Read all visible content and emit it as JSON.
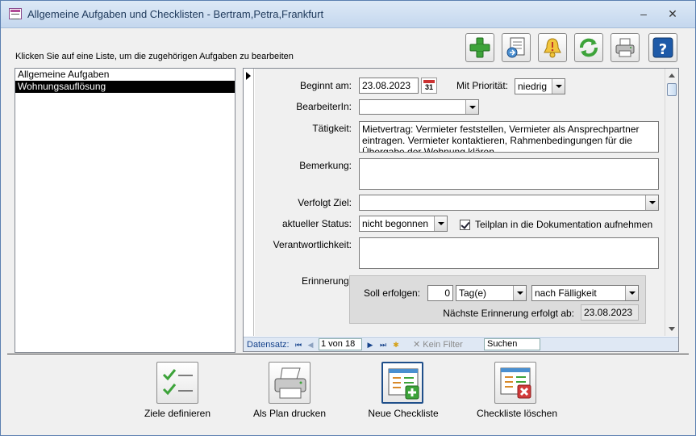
{
  "window": {
    "title": "Allgemeine Aufgaben und Checklisten - Bertram,Petra,Frankfurt",
    "minimize": "–",
    "close": "✕"
  },
  "instruction": "Klicken Sie auf eine Liste, um die zugehörigen Aufgaben zu bearbeiten",
  "lists": [
    {
      "label": "Allgemeine Aufgaben",
      "selected": false
    },
    {
      "label": "Wohnungsauflösung",
      "selected": true
    }
  ],
  "form": {
    "begin_label": "Beginnt am:",
    "begin_value": "23.08.2023",
    "calendar_day": "31",
    "priority_label": "Mit Priorität:",
    "priority_value": "niedrig",
    "assignee_label": "BearbeiterIn:",
    "assignee_value": "",
    "activity_label": "Tätigkeit:",
    "activity_value": "Mietvertrag: Vermieter feststellen, Vermieter als Ansprechpartner eintragen. Vermieter kontaktieren, Rahmenbedingungen für die Übergabe der Wohnung klären",
    "remark_label": "Bemerkung:",
    "remark_value": "",
    "goal_label": "Verfolgt Ziel:",
    "goal_value": "",
    "status_label": "aktueller Status:",
    "status_value": "nicht begonnen",
    "subplan_label": "Teilplan in die Dokumentation aufnehmen",
    "subplan_checked": true,
    "responsibility_label": "Verantwortlichkeit:",
    "responsibility_value": "",
    "reminder_label": "Erinnerung:",
    "reminder_due_label": "Soll erfolgen:",
    "reminder_amount": "0",
    "reminder_unit": "Tag(e)",
    "reminder_relation": "nach Fälligkeit",
    "reminder_next_label": "Nächste Erinnerung erfolgt ab:",
    "reminder_next_value": "23.08.2023"
  },
  "navigation": {
    "record_label": "Datensatz:",
    "record_position": "1 von 18",
    "filter_label": "Kein Filter",
    "search_label": "Suchen"
  },
  "toolbar_icons": [
    "add-icon",
    "export-icon",
    "alarm-bell-icon",
    "refresh-icon",
    "print-icon",
    "help-icon"
  ],
  "bottom_buttons": [
    {
      "label": "Ziele definieren",
      "icon": "checklist-icon"
    },
    {
      "label": "Als Plan drucken",
      "icon": "printer-icon"
    },
    {
      "label": "Neue Checkliste",
      "icon": "new-checklist-icon"
    },
    {
      "label": "Checkliste löschen",
      "icon": "delete-checklist-icon"
    }
  ],
  "colors": {
    "accent_green": "#3da33a",
    "delete_red": "#d23a3a",
    "help_blue": "#1e5aa8",
    "nav_text": "#15428b"
  }
}
